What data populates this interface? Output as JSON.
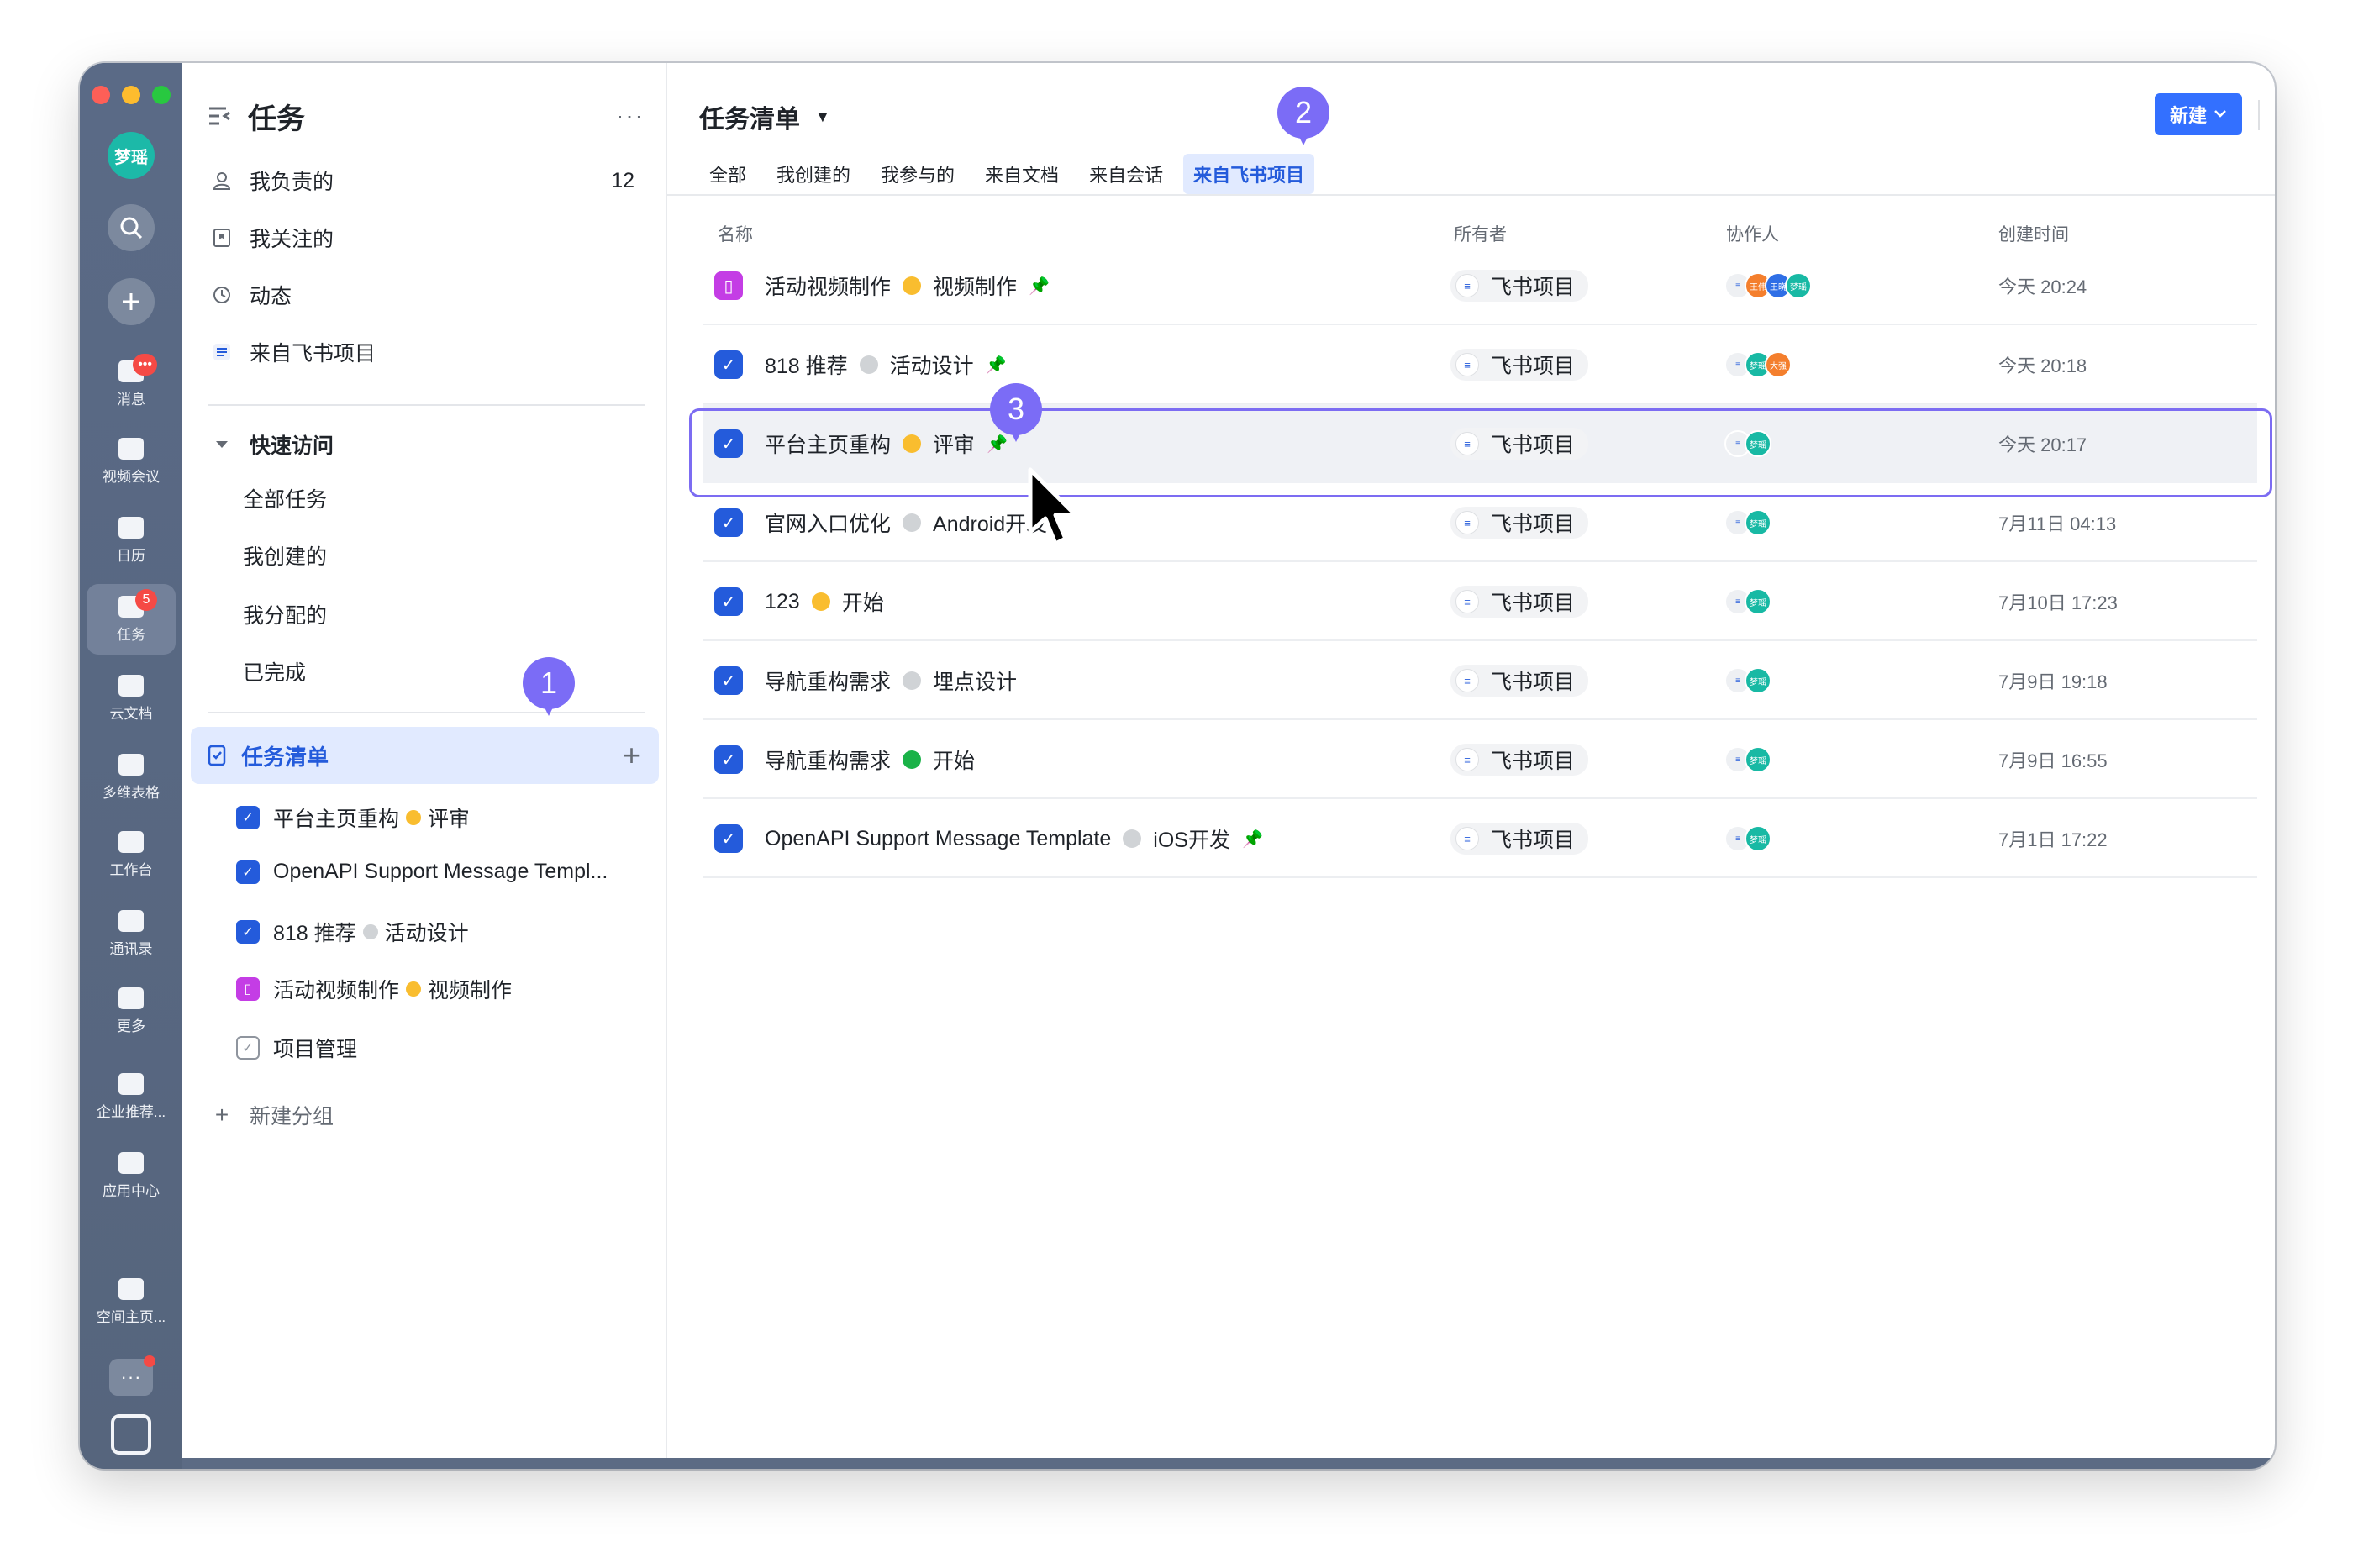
{
  "rail": {
    "avatar": "梦瑶",
    "items": [
      {
        "label": "消息",
        "badge": "•••"
      },
      {
        "label": "视频会议"
      },
      {
        "label": "日历"
      },
      {
        "label": "任务",
        "badge": "5"
      },
      {
        "label": "云文档"
      },
      {
        "label": "多维表格"
      },
      {
        "label": "工作台"
      },
      {
        "label": "通讯录"
      },
      {
        "label": "更多"
      },
      {
        "label": "企业推荐..."
      },
      {
        "label": "应用中心"
      },
      {
        "label": "空间主页..."
      }
    ],
    "more_dots": "···"
  },
  "sidebar": {
    "title": "任务",
    "more": "···",
    "nav": [
      {
        "label": "我负责的",
        "count": "12"
      },
      {
        "label": "我关注的"
      },
      {
        "label": "动态"
      },
      {
        "label": "来自飞书项目"
      }
    ],
    "quick_access": {
      "label": "快速访问",
      "items": [
        "全部任务",
        "我创建的",
        "我分配的",
        "已完成"
      ]
    },
    "tasklists": {
      "label": "任务清单",
      "add": "+",
      "items": [
        {
          "name": "平台主页重构",
          "status": "评审",
          "status_color": "#f9bd2f"
        },
        {
          "name": "OpenAPI Support Message Templ...",
          "status": "",
          "status_color": ""
        },
        {
          "name": "818 推荐",
          "status": "活动设计",
          "status_color": "#d0d3d6"
        },
        {
          "name": "活动视频制作",
          "status": "视频制作",
          "status_color": "#f9bd2f"
        },
        {
          "name": "项目管理",
          "status": "",
          "status_color": ""
        }
      ]
    },
    "new_group": "新建分组"
  },
  "main": {
    "title": "任务清单",
    "tabs": [
      "全部",
      "我创建的",
      "我参与的",
      "来自文档",
      "来自会话",
      "来自飞书项目"
    ],
    "active_tab": "来自飞书项目",
    "new_button": "新建",
    "columns": [
      "名称",
      "所有者",
      "协作人",
      "创建时间"
    ],
    "rows": [
      {
        "name": "活动视频制作",
        "status": "视频制作",
        "status_color": "#f9bd2f",
        "pinned": true,
        "owner": "飞书项目",
        "collaborators": [
          "王伟",
          "王晓",
          "梦瑶"
        ],
        "created": "今天 20:24",
        "icon": "pink"
      },
      {
        "name": "818 推荐",
        "status": "活动设计",
        "status_color": "#d0d3d6",
        "pinned": true,
        "owner": "飞书项目",
        "collaborators": [
          "梦瑶",
          "大强"
        ],
        "created": "今天 20:18",
        "icon": "blue"
      },
      {
        "name": "平台主页重构",
        "status": "评审",
        "status_color": "#f9bd2f",
        "pinned": true,
        "owner": "飞书项目",
        "collaborators": [
          "梦瑶"
        ],
        "created": "今天 20:17",
        "icon": "blue"
      },
      {
        "name": "官网入口优化",
        "status": "Android开发",
        "status_color": "#d0d3d6",
        "pinned": false,
        "owner": "飞书项目",
        "collaborators": [
          "梦瑶"
        ],
        "created": "7月11日 04:13",
        "icon": "blue"
      },
      {
        "name": "123",
        "status": "开始",
        "status_color": "#f9bd2f",
        "pinned": false,
        "owner": "飞书项目",
        "collaborators": [
          "梦瑶"
        ],
        "created": "7月10日 17:23",
        "icon": "blue"
      },
      {
        "name": "导航重构需求",
        "status": "埋点设计",
        "status_color": "#d0d3d6",
        "pinned": false,
        "owner": "飞书项目",
        "collaborators": [
          "梦瑶"
        ],
        "created": "7月9日 19:18",
        "icon": "blue"
      },
      {
        "name": "导航重构需求",
        "status": "开始",
        "status_color": "#1ab248",
        "pinned": false,
        "owner": "飞书项目",
        "collaborators": [
          "梦瑶"
        ],
        "created": "7月9日 16:55",
        "icon": "blue"
      },
      {
        "name": "OpenAPI Support Message Template",
        "status": "iOS开发",
        "status_color": "#d0d3d6",
        "pinned": true,
        "owner": "飞书项目",
        "collaborators": [
          "梦瑶"
        ],
        "created": "7月1日 17:22",
        "icon": "blue"
      }
    ]
  },
  "markers": [
    "1",
    "2",
    "3"
  ],
  "colors": {
    "accent": "#3370ff",
    "selected_bg": "#e1eaff",
    "marker": "#7b6cf6",
    "rail": "#5a6a86"
  }
}
